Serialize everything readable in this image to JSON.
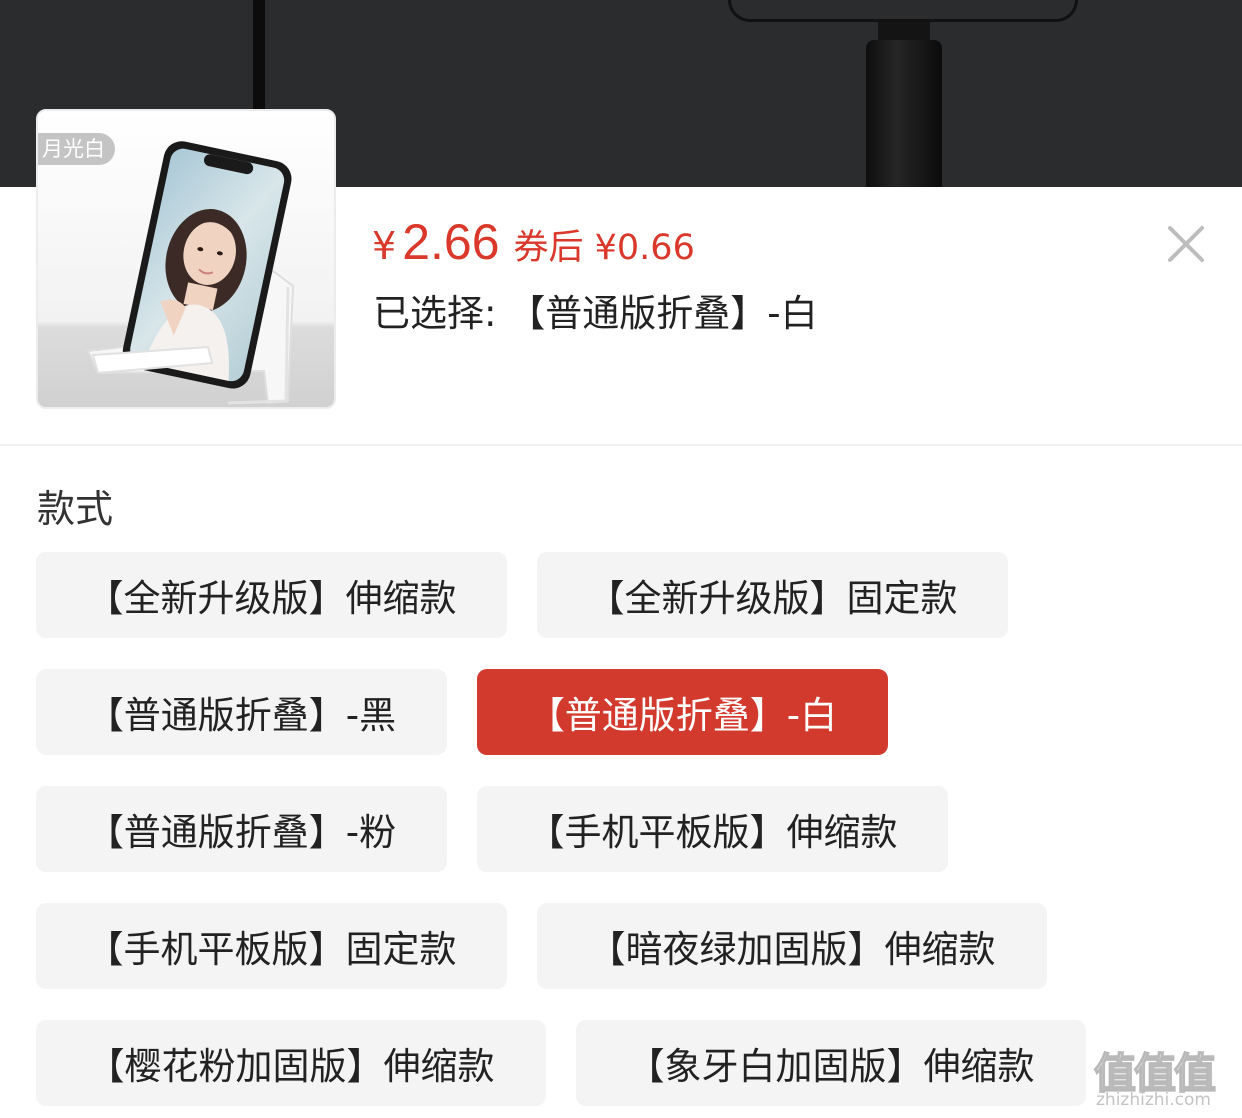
{
  "product": {
    "thumbnail_tag": "月光白",
    "price_symbol": "¥",
    "price": "2.66",
    "coupon_price": "券后 ¥0.66",
    "selected_text": "已选择: 【普通版折叠】-白"
  },
  "icons": {
    "close": "close-icon"
  },
  "spec": {
    "title": "款式",
    "options": [
      {
        "label": "【全新升级版】伸缩款",
        "active": false
      },
      {
        "label": "【全新升级版】固定款",
        "active": false
      },
      {
        "label": "【普通版折叠】-黑",
        "active": false
      },
      {
        "label": "【普通版折叠】-白",
        "active": true
      },
      {
        "label": "【普通版折叠】-粉",
        "active": false
      },
      {
        "label": "【手机平板版】伸缩款",
        "active": false
      },
      {
        "label": "【手机平板版】固定款",
        "active": false
      },
      {
        "label": "【暗夜绿加固版】伸缩款",
        "active": false
      },
      {
        "label": "【樱花粉加固版】伸缩款",
        "active": false
      },
      {
        "label": "【象牙白加固版】伸缩款",
        "active": false
      }
    ]
  },
  "colors": {
    "accent": "#d33a2e",
    "option_bg": "#f4f4f4"
  },
  "watermark": {
    "glyphs": "值值值",
    "url": "zhizhizhi.com"
  }
}
